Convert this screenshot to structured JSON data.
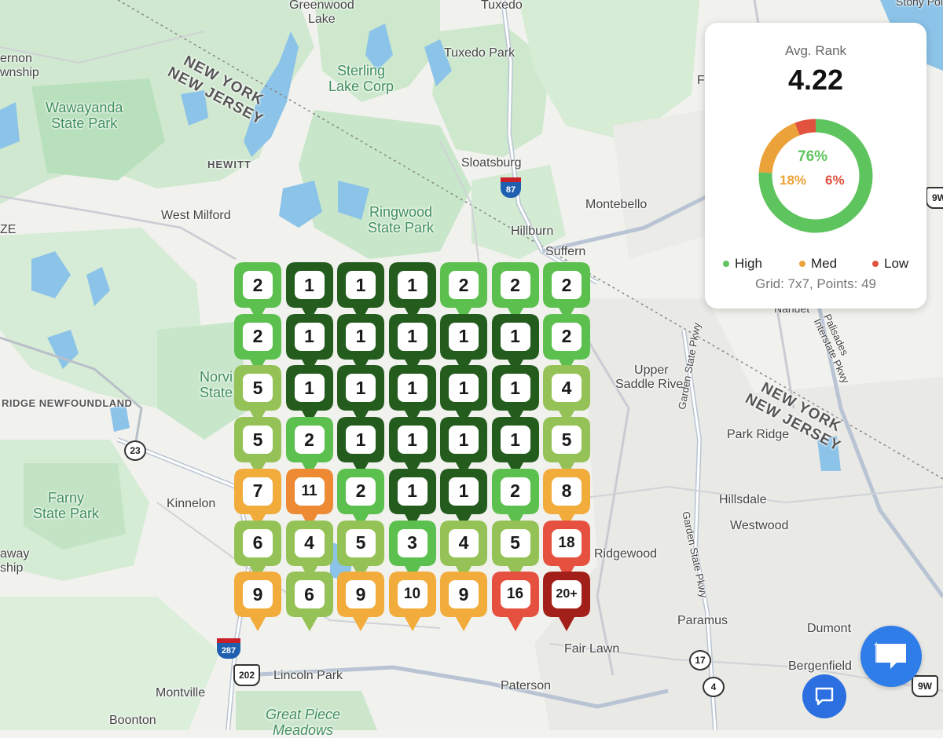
{
  "summary": {
    "title": "Avg. Rank",
    "value": "4.22",
    "pct_high": "76%",
    "pct_med": "18%",
    "pct_low": "6%",
    "share_high": 76,
    "share_med": 18,
    "share_low": 6,
    "legend_high": "High",
    "legend_med": "Med",
    "legend_low": "Low",
    "grid_info": "Grid: 7x7, Points: 49"
  },
  "colors": {
    "high": "#5ec45e",
    "med": "#eba239",
    "low": "#e2533f",
    "rank1": "#245c1e",
    "rank2_3": "#5cc04e",
    "rank4_6": "#95c256",
    "rank7_10": "#f2ac3c",
    "rank11": "#ed8a33",
    "rank16_18": "#e5503f",
    "rank20plus": "#a21f1a",
    "chat": "#2f7de8"
  },
  "grid": {
    "rows": [
      [
        "2",
        "1",
        "1",
        "1",
        "2",
        "2",
        "2"
      ],
      [
        "2",
        "1",
        "1",
        "1",
        "1",
        "1",
        "2"
      ],
      [
        "5",
        "1",
        "1",
        "1",
        "1",
        "1",
        "4"
      ],
      [
        "5",
        "2",
        "1",
        "1",
        "1",
        "1",
        "5"
      ],
      [
        "7",
        "11",
        "2",
        "1",
        "1",
        "2",
        "8"
      ],
      [
        "6",
        "4",
        "5",
        "3",
        "4",
        "5",
        "18"
      ],
      [
        "9",
        "6",
        "9",
        "10",
        "9",
        "16",
        "20+"
      ]
    ]
  },
  "map": {
    "labels": {
      "greenwood": "Greenwood\nLake",
      "tuxedo": "Tuxedo",
      "tuxedo_park": "Tuxedo Park",
      "sterling": "Sterling\nLake Corp",
      "wawayanda": "Wawayanda\nState Park",
      "vernon": "ernon\nwnship",
      "hewitt": "HEWITT",
      "west_milford": "West Milford",
      "sloatsburg": "Sloatsburg",
      "ringwood": "Ringwood\nState Park",
      "montebello": "Montebello",
      "hillburn": "Hillburn",
      "suffern": "Suffern",
      "newfoundland": "RIDGE  NEWFOUNDLAND",
      "norvin": "Norvi\nState",
      "farny": "Farny\nState Park",
      "kinnelon": "Kinnelon",
      "upper_saddle": "Upper\nSaddle River",
      "park_ridge": "Park Ridge",
      "hillsdale": "Hillsdale",
      "westwood": "Westwood",
      "ridgewood": "Ridgewood",
      "paramus": "Paramus",
      "dumont": "Dumont",
      "bergenfield": "Bergenfield",
      "fair_lawn": "Fair Lawn",
      "paterson": "Paterson",
      "lincoln_park": "Lincoln Park",
      "montville": "Montville",
      "boonton": "Boonton",
      "great_piece": "Great Piece\nMeadows",
      "ship_left": "away\nship",
      "ze": "ZE",
      "nanuet": "Nanuet",
      "gsp": "Garden State Pkwy",
      "gsp2": "Garden State Pkwy",
      "pal": "Palisades\nInterstate Pkwy",
      "ny_nj_1": "NEW YORK\nNEW JERSEY",
      "ny_nj_2": "NEW YORK\nNEW JERSEY",
      "stony_point": "Stony Point",
      "right_edge": "F"
    },
    "shields": {
      "i87": "87",
      "r23": "23",
      "i287": "287",
      "us202": "202",
      "r17": "17",
      "r4": "4",
      "us9w": "9W",
      "us9w_top": "9W"
    }
  }
}
